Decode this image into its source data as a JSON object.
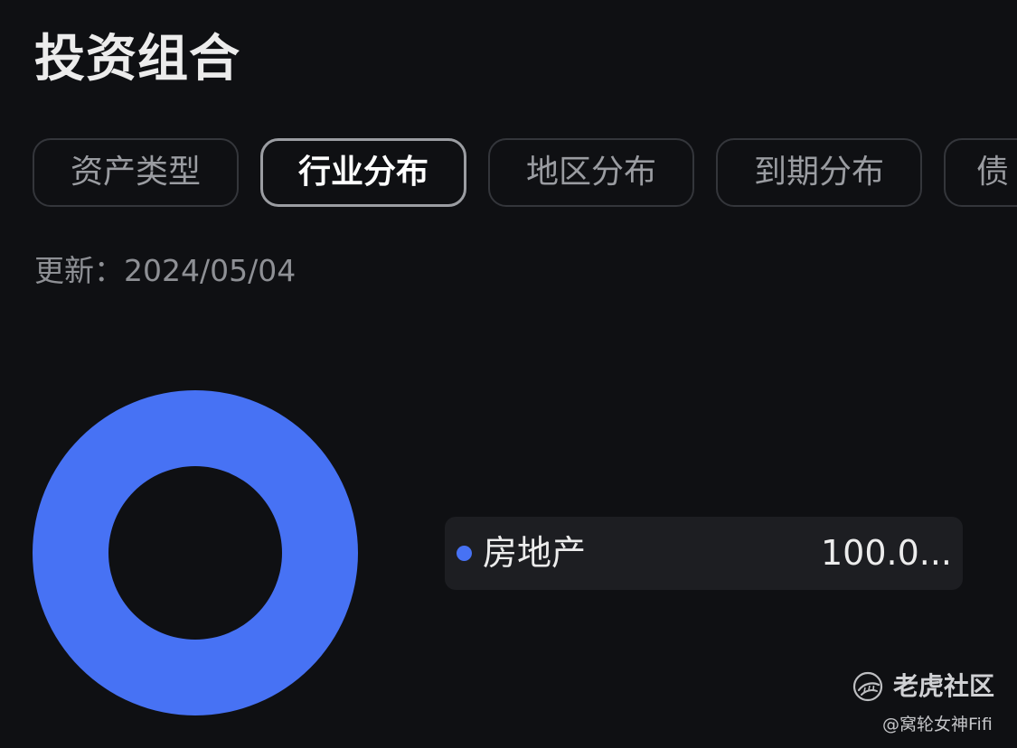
{
  "page": {
    "title": "投资组合"
  },
  "tabs": [
    {
      "label": "资产类型",
      "active": false
    },
    {
      "label": "行业分布",
      "active": true
    },
    {
      "label": "地区分布",
      "active": false
    },
    {
      "label": "到期分布",
      "active": false
    },
    {
      "label": "债",
      "active": false
    }
  ],
  "update": {
    "text": "更新：2024/05/04"
  },
  "chart_data": {
    "type": "pie",
    "categories": [
      "房地产"
    ],
    "values": [
      100.0
    ],
    "colors": [
      "#4772f4"
    ],
    "legend_value_text": "100.0...",
    "legend_position": "right",
    "donut": true
  },
  "colors": {
    "background": "#0f1013",
    "accent": "#4772f4",
    "legend_bg": "#1d1e22"
  },
  "watermark": {
    "icon": "tiger-logo-icon",
    "brand": "老虎社区",
    "author": "@窝轮女神Fifi"
  }
}
